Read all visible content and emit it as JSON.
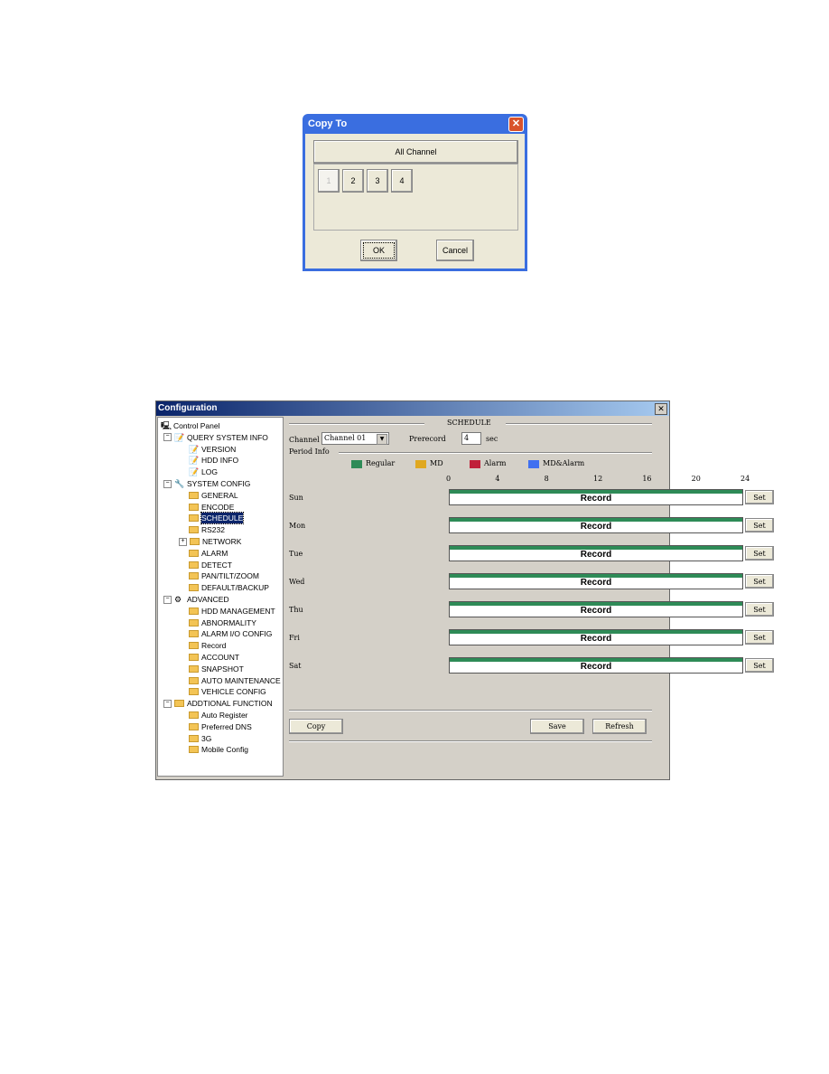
{
  "copy_dialog": {
    "title": "Copy To",
    "all_label": "All Channel",
    "channels": [
      "1",
      "2",
      "3",
      "4"
    ],
    "ok": "OK",
    "cancel": "Cancel"
  },
  "config": {
    "title": "Configuration",
    "close": "✕",
    "tree": [
      {
        "label": "Control Panel",
        "level": 0,
        "icon": "computer-icon"
      },
      {
        "label": "QUERY SYSTEM INFO",
        "level": 1,
        "icon": "notepad-icon",
        "toggle": "−"
      },
      {
        "label": "VERSION",
        "level": 2,
        "icon": "notepad-icon"
      },
      {
        "label": "HDD INFO",
        "level": 2,
        "icon": "notepad-icon"
      },
      {
        "label": "LOG",
        "level": 2,
        "icon": "notepad-icon"
      },
      {
        "label": "SYSTEM CONFIG",
        "level": 1,
        "icon": "tools-icon",
        "toggle": "−"
      },
      {
        "label": "GENERAL",
        "level": 2,
        "icon": "folder-icon"
      },
      {
        "label": "ENCODE",
        "level": 2,
        "icon": "folder-icon"
      },
      {
        "label": "SCHEDULE",
        "level": 2,
        "icon": "folder-icon",
        "selected": true
      },
      {
        "label": "RS232",
        "level": 2,
        "icon": "folder-icon"
      },
      {
        "label": "NETWORK",
        "level": 2,
        "icon": "folder-icon",
        "toggle": "+"
      },
      {
        "label": "ALARM",
        "level": 2,
        "icon": "folder-icon"
      },
      {
        "label": "DETECT",
        "level": 2,
        "icon": "folder-icon"
      },
      {
        "label": "PAN/TILT/ZOOM",
        "level": 2,
        "icon": "folder-icon"
      },
      {
        "label": "DEFAULT/BACKUP",
        "level": 2,
        "icon": "folder-icon"
      },
      {
        "label": "ADVANCED",
        "level": 1,
        "icon": "gears-icon",
        "toggle": "−"
      },
      {
        "label": "HDD MANAGEMENT",
        "level": 2,
        "icon": "folder-icon"
      },
      {
        "label": "ABNORMALITY",
        "level": 2,
        "icon": "folder-icon"
      },
      {
        "label": "ALARM I/O CONFIG",
        "level": 2,
        "icon": "folder-icon"
      },
      {
        "label": "Record",
        "level": 2,
        "icon": "folder-icon"
      },
      {
        "label": "ACCOUNT",
        "level": 2,
        "icon": "folder-icon"
      },
      {
        "label": "SNAPSHOT",
        "level": 2,
        "icon": "folder-icon"
      },
      {
        "label": "AUTO MAINTENANCE",
        "level": 2,
        "icon": "folder-icon"
      },
      {
        "label": "VEHICLE CONFIG",
        "level": 2,
        "icon": "folder-icon"
      },
      {
        "label": "ADDTIONAL FUNCTION",
        "level": 1,
        "icon": "folder-icon",
        "toggle": "−"
      },
      {
        "label": "Auto Register",
        "level": 2,
        "icon": "folder-icon"
      },
      {
        "label": "Preferred DNS",
        "level": 2,
        "icon": "folder-icon"
      },
      {
        "label": "3G",
        "level": 2,
        "icon": "folder-icon"
      },
      {
        "label": "Mobile Config",
        "level": 2,
        "icon": "folder-icon"
      }
    ],
    "schedule": {
      "heading": "SCHEDULE",
      "channel_label": "Channel",
      "channel_value": "Channel 01",
      "prerecord_label": "Prerecord",
      "prerecord_value": "4",
      "sec_label": "sec",
      "period_label": "Period Info",
      "legend": [
        {
          "label": "Regular",
          "color": "#2e8b57"
        },
        {
          "label": "MD",
          "color": "#e0a820"
        },
        {
          "label": "Alarm",
          "color": "#c0203a"
        },
        {
          "label": "MD&Alarm",
          "color": "#4070f0"
        }
      ],
      "hours": [
        "0",
        "4",
        "8",
        "12",
        "16",
        "20",
        "24"
      ],
      "days": [
        {
          "day": "Sun",
          "text": "Record"
        },
        {
          "day": "Mon",
          "text": "Record"
        },
        {
          "day": "Tue",
          "text": "Record"
        },
        {
          "day": "Wed",
          "text": "Record"
        },
        {
          "day": "Thu",
          "text": "Record"
        },
        {
          "day": "Fri",
          "text": "Record"
        },
        {
          "day": "Sat",
          "text": "Record"
        }
      ],
      "set_label": "Set",
      "copy": "Copy",
      "save": "Save",
      "refresh": "Refresh"
    }
  }
}
